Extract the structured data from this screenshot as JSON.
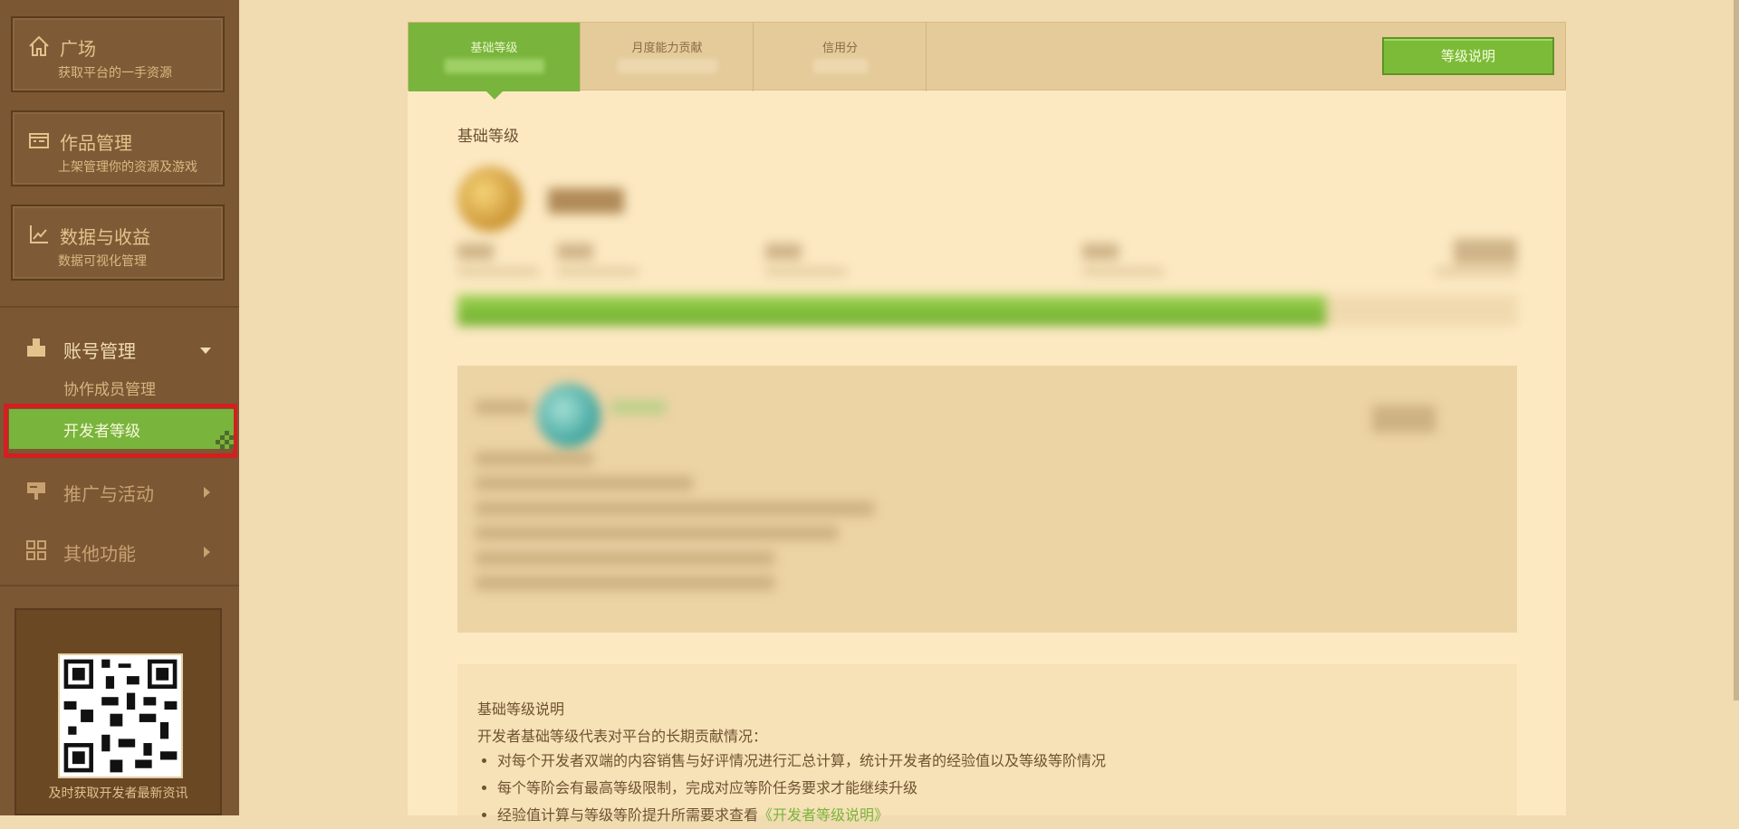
{
  "sidebar": {
    "cards": [
      {
        "icon": "home-icon",
        "title": "广场",
        "subtitle": "获取平台的一手资源"
      },
      {
        "icon": "folder-icon",
        "title": "作品管理",
        "subtitle": "上架管理你的资源及游戏"
      },
      {
        "icon": "chart-icon",
        "title": "数据与收益",
        "subtitle": "数据可视化管理"
      }
    ],
    "account": {
      "label": "账号管理",
      "items": [
        "协作成员管理",
        "开发者等级"
      ]
    },
    "promo_label": "推广与活动",
    "other_label": "其他功能",
    "qr_caption": "及时获取开发者最新资讯"
  },
  "tabs": [
    {
      "label": "基础等级",
      "active": true
    },
    {
      "label": "月度能力贡献",
      "active": false
    },
    {
      "label": "信用分",
      "active": false
    }
  ],
  "level_button": "等级说明",
  "section_title": "基础等级",
  "progress": {
    "fraction": 0.82
  },
  "description": {
    "heading": "基础等级说明",
    "intro": "开发者基础等级代表对平台的长期贡献情况：",
    "bullets": [
      "对每个开发者双端的内容销售与好评情况进行汇总计算，统计开发者的经验值以及等级等阶情况",
      "每个等阶会有最高等级限制，完成对应等阶任务要求才能继续升级"
    ],
    "bullet3_text": "经验值计算与等级等阶提升所需要求查看",
    "bullet3_link": "《开发者等级说明》"
  },
  "colors": {
    "accent": "#79b43c",
    "highlight": "#d21f1f",
    "sidebar_bg": "#7b5734"
  }
}
